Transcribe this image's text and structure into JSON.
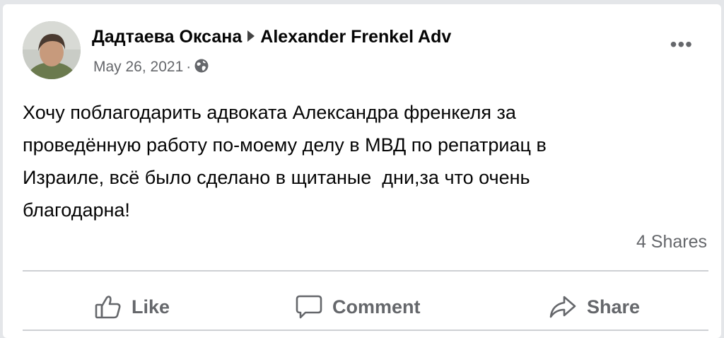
{
  "post": {
    "author": "Дадтаева Оксана",
    "target_page": "Alexander Frenkel Adv",
    "date": "May 26, 2021",
    "separator": "·",
    "audience_icon": "globe-icon",
    "more_icon": "more-options-icon",
    "body": "Хочу поблагодарить адвоката Александра френкеля за\nпроведённую работу по-моему делу в МВД по репатриац в\nИзраиле, всё было сделано в щитаные  дни,за что очень\nблагодарна!",
    "shares": "4 Shares"
  },
  "actions": {
    "like": "Like",
    "comment": "Comment",
    "share": "Share"
  },
  "colors": {
    "text_primary": "#050505",
    "text_secondary": "#65676b",
    "divider": "#ced0d4",
    "background": "#ffffff"
  }
}
